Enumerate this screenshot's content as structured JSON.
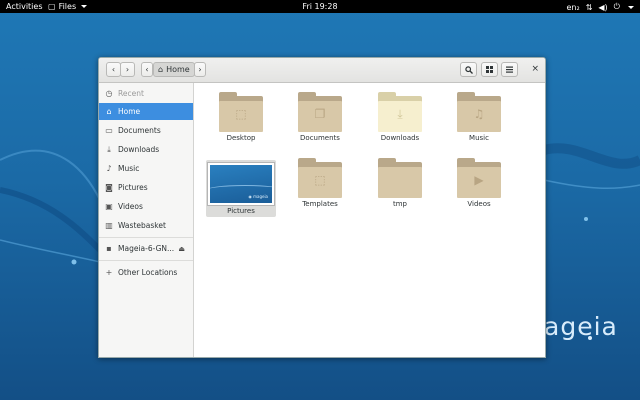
{
  "topbar": {
    "activities": "Activities",
    "app_name": "Files",
    "clock": "Fri 19:28",
    "network": "en₂"
  },
  "desktop": {
    "brand_text": "ageia"
  },
  "window": {
    "path_label": "Home",
    "close": "×"
  },
  "sidebar": {
    "items": [
      {
        "label": "Recent",
        "icon": "clock-icon"
      },
      {
        "label": "Home",
        "icon": "home-icon"
      },
      {
        "label": "Documents",
        "icon": "document-icon"
      },
      {
        "label": "Downloads",
        "icon": "download-icon"
      },
      {
        "label": "Music",
        "icon": "music-icon"
      },
      {
        "label": "Pictures",
        "icon": "camera-icon"
      },
      {
        "label": "Videos",
        "icon": "film-icon"
      },
      {
        "label": "Wastebasket",
        "icon": "trash-icon"
      },
      {
        "label": "Mageia-6-GN...",
        "icon": "disc-icon"
      },
      {
        "label": "Other Locations",
        "icon": "plus-icon"
      }
    ],
    "selected": "Home"
  },
  "files": [
    {
      "label": "Desktop",
      "type": "folder",
      "emblem": "desktop-emblem"
    },
    {
      "label": "Documents",
      "type": "folder",
      "emblem": "document-emblem"
    },
    {
      "label": "Downloads",
      "type": "folder",
      "emblem": "download-emblem"
    },
    {
      "label": "Music",
      "type": "folder",
      "emblem": "music-emblem"
    },
    {
      "label": "Pictures",
      "type": "image-thumbnail"
    },
    {
      "label": "Templates",
      "type": "folder",
      "emblem": "template-emblem"
    },
    {
      "label": "tmp",
      "type": "folder"
    },
    {
      "label": "Videos",
      "type": "folder",
      "emblem": "video-emblem"
    }
  ],
  "colors": {
    "accent": "#3d8ee0",
    "folder": "#d8c8a8",
    "desktop_blue": "#1f78b6"
  }
}
